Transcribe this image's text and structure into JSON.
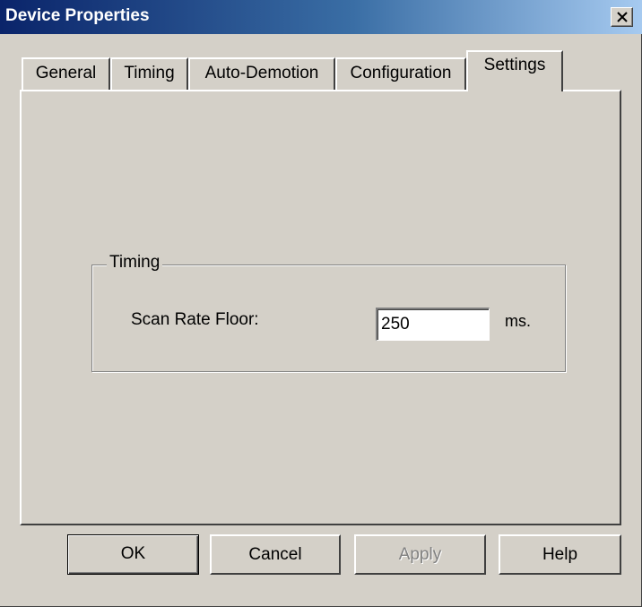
{
  "window": {
    "title": "Device Properties"
  },
  "tabs": [
    {
      "label": "General",
      "active": false
    },
    {
      "label": "Timing",
      "active": false
    },
    {
      "label": "Auto-Demotion",
      "active": false
    },
    {
      "label": "Configuration",
      "active": false
    },
    {
      "label": "Settings",
      "active": true
    }
  ],
  "settings": {
    "group_title": "Timing",
    "scan_rate_label": "Scan Rate Floor:",
    "scan_rate_value": "250",
    "scan_rate_unit": "ms."
  },
  "buttons": {
    "ok": "OK",
    "cancel": "Cancel",
    "apply": "Apply",
    "help": "Help"
  },
  "colors": {
    "face": "#d4d0c8",
    "title_start": "#0a246a",
    "title_end": "#a6caf0"
  }
}
